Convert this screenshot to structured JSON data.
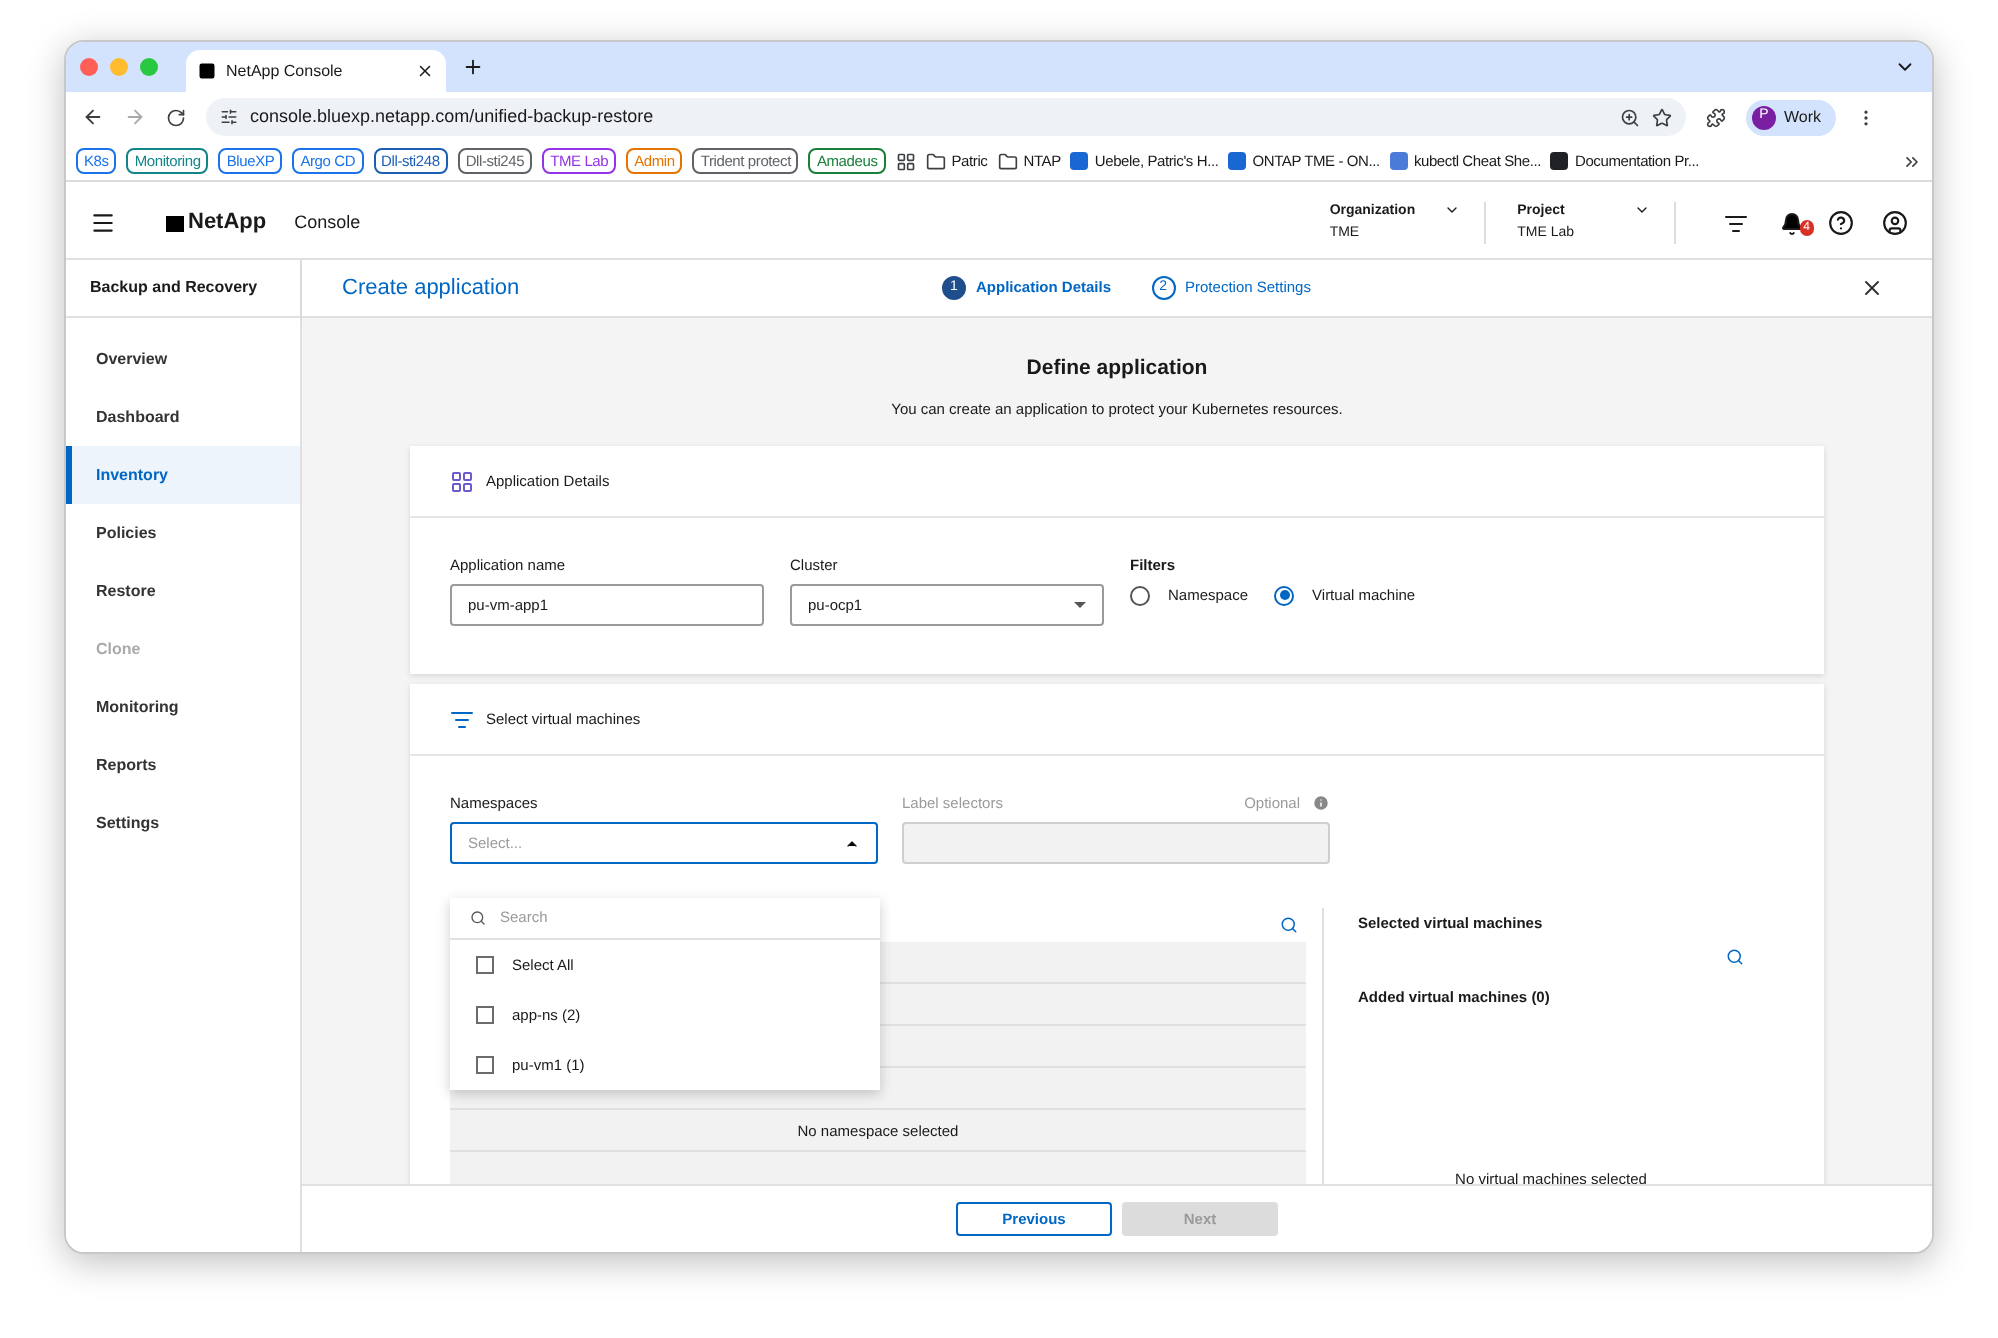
{
  "browser": {
    "tab_title": "NetApp Console",
    "url": "console.bluexp.netapp.com/unified-backup-restore",
    "profile_initial": "P",
    "profile_name": "Work",
    "bookmarks": [
      {
        "kind": "pill",
        "label": "K8s",
        "color": "#1a73e8"
      },
      {
        "kind": "pill",
        "label": "Monitoring",
        "color": "#12858a"
      },
      {
        "kind": "pill",
        "label": "BlueXP",
        "color": "#1a73e8"
      },
      {
        "kind": "pill",
        "label": "Argo CD",
        "color": "#1a73e8"
      },
      {
        "kind": "pill",
        "label": "Dll-sti248",
        "color": "#1a5fb4"
      },
      {
        "kind": "pill",
        "label": "Dll-sti245",
        "color": "#5f6368"
      },
      {
        "kind": "pill",
        "label": "TME Lab",
        "color": "#9334e6"
      },
      {
        "kind": "pill",
        "label": "Admin",
        "color": "#e37400"
      },
      {
        "kind": "pill",
        "label": "Trident protect",
        "color": "#5f6368"
      },
      {
        "kind": "pill",
        "label": "Amadeus",
        "color": "#188038"
      },
      {
        "kind": "apps"
      },
      {
        "kind": "folder",
        "label": "Patric"
      },
      {
        "kind": "folder",
        "label": "NTAP"
      },
      {
        "kind": "link",
        "label": "Uebele, Patric's H...",
        "color": "#1967d2"
      },
      {
        "kind": "link",
        "label": "ONTAP TME - ON...",
        "color": "#1967d2"
      },
      {
        "kind": "link",
        "label": "kubectl Cheat She...",
        "color": "#4a7bd8"
      },
      {
        "kind": "link",
        "label": "Documentation Pr...",
        "color": "#202124"
      }
    ]
  },
  "header": {
    "brand": "NetApp",
    "product": "Console",
    "org_label": "Organization",
    "org_value": "TME",
    "project_label": "Project",
    "project_value": "TME Lab",
    "notification_count": "4"
  },
  "sidebar": {
    "title": "Backup and Recovery",
    "items": [
      {
        "label": "Overview",
        "selected": false,
        "disabled": false
      },
      {
        "label": "Dashboard",
        "selected": false,
        "disabled": false
      },
      {
        "label": "Inventory",
        "selected": true,
        "disabled": false
      },
      {
        "label": "Policies",
        "selected": false,
        "disabled": false
      },
      {
        "label": "Restore",
        "selected": false,
        "disabled": false
      },
      {
        "label": "Clone",
        "selected": false,
        "disabled": true
      },
      {
        "label": "Monitoring",
        "selected": false,
        "disabled": false
      },
      {
        "label": "Reports",
        "selected": false,
        "disabled": false
      },
      {
        "label": "Settings",
        "selected": false,
        "disabled": false
      }
    ]
  },
  "wizard": {
    "title": "Create application",
    "steps": [
      {
        "number": "1",
        "label": "Application Details",
        "selected": true
      },
      {
        "number": "2",
        "label": "Protection Settings",
        "selected": false
      }
    ]
  },
  "page": {
    "title": "Define application",
    "subtitle": "You can create an application to protect your Kubernetes resources."
  },
  "details": {
    "title": "Application Details",
    "name_label": "Application name",
    "name_value": "pu-vm-app1",
    "cluster_label": "Cluster",
    "cluster_value": "pu-ocp1",
    "filters_label": "Filters",
    "filters": [
      {
        "label": "Namespace",
        "selected": false
      },
      {
        "label": "Virtual machine",
        "selected": true
      }
    ]
  },
  "vm_select": {
    "title": "Select virtual machines",
    "namespaces_label": "Namespaces",
    "namespaces_placeholder": "Select...",
    "expanded": true,
    "search_placeholder": "Search",
    "options": [
      {
        "label": "Select All",
        "checked": false
      },
      {
        "label": "app-ns (2)",
        "checked": false
      },
      {
        "label": "pu-vm1 (1)",
        "checked": false
      }
    ],
    "label_selectors_label": "Label selectors",
    "label_selectors_disabled": true,
    "optional": "Optional",
    "empty_message": "No namespace selected",
    "selected_title": "Selected virtual machines",
    "added_label": "Added virtual machines (0)",
    "selected_empty": "No virtual machines selected"
  },
  "footer": {
    "buttons": [
      {
        "label": "Previous",
        "disabled": false
      },
      {
        "label": "Next",
        "disabled": true
      }
    ]
  }
}
